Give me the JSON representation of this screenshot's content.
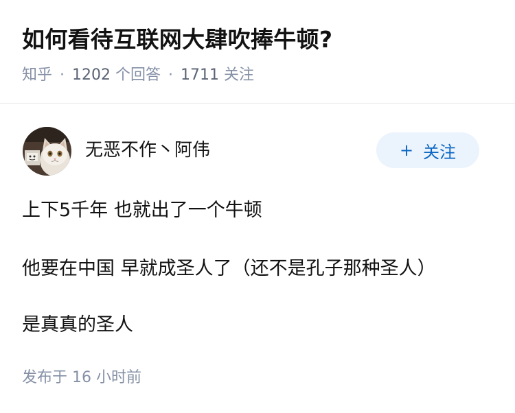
{
  "question": {
    "title": "如何看待互联网大肆吹捧牛顿?",
    "source": "知乎",
    "separator": "·",
    "answer_count": "1202",
    "answer_label": "个回答",
    "follower_count": "1711",
    "follower_label": "关注"
  },
  "answer": {
    "author": {
      "name": "无恶不作丶阿伟",
      "avatar_icon": "cat-avatar"
    },
    "follow_button": {
      "icon": "+",
      "label": "关注"
    },
    "content": [
      "上下5千年 也就出了一个牛顿",
      "他要在中国 早就成圣人了（还不是孔子那种圣人）",
      "是真真的圣人"
    ],
    "publish_time": "发布于 16 小时前"
  },
  "colors": {
    "accent": "#0a66c2",
    "follow_button_bg": "#ebf3fd",
    "meta_text": "#8590a6",
    "divider": "#ebebeb"
  }
}
